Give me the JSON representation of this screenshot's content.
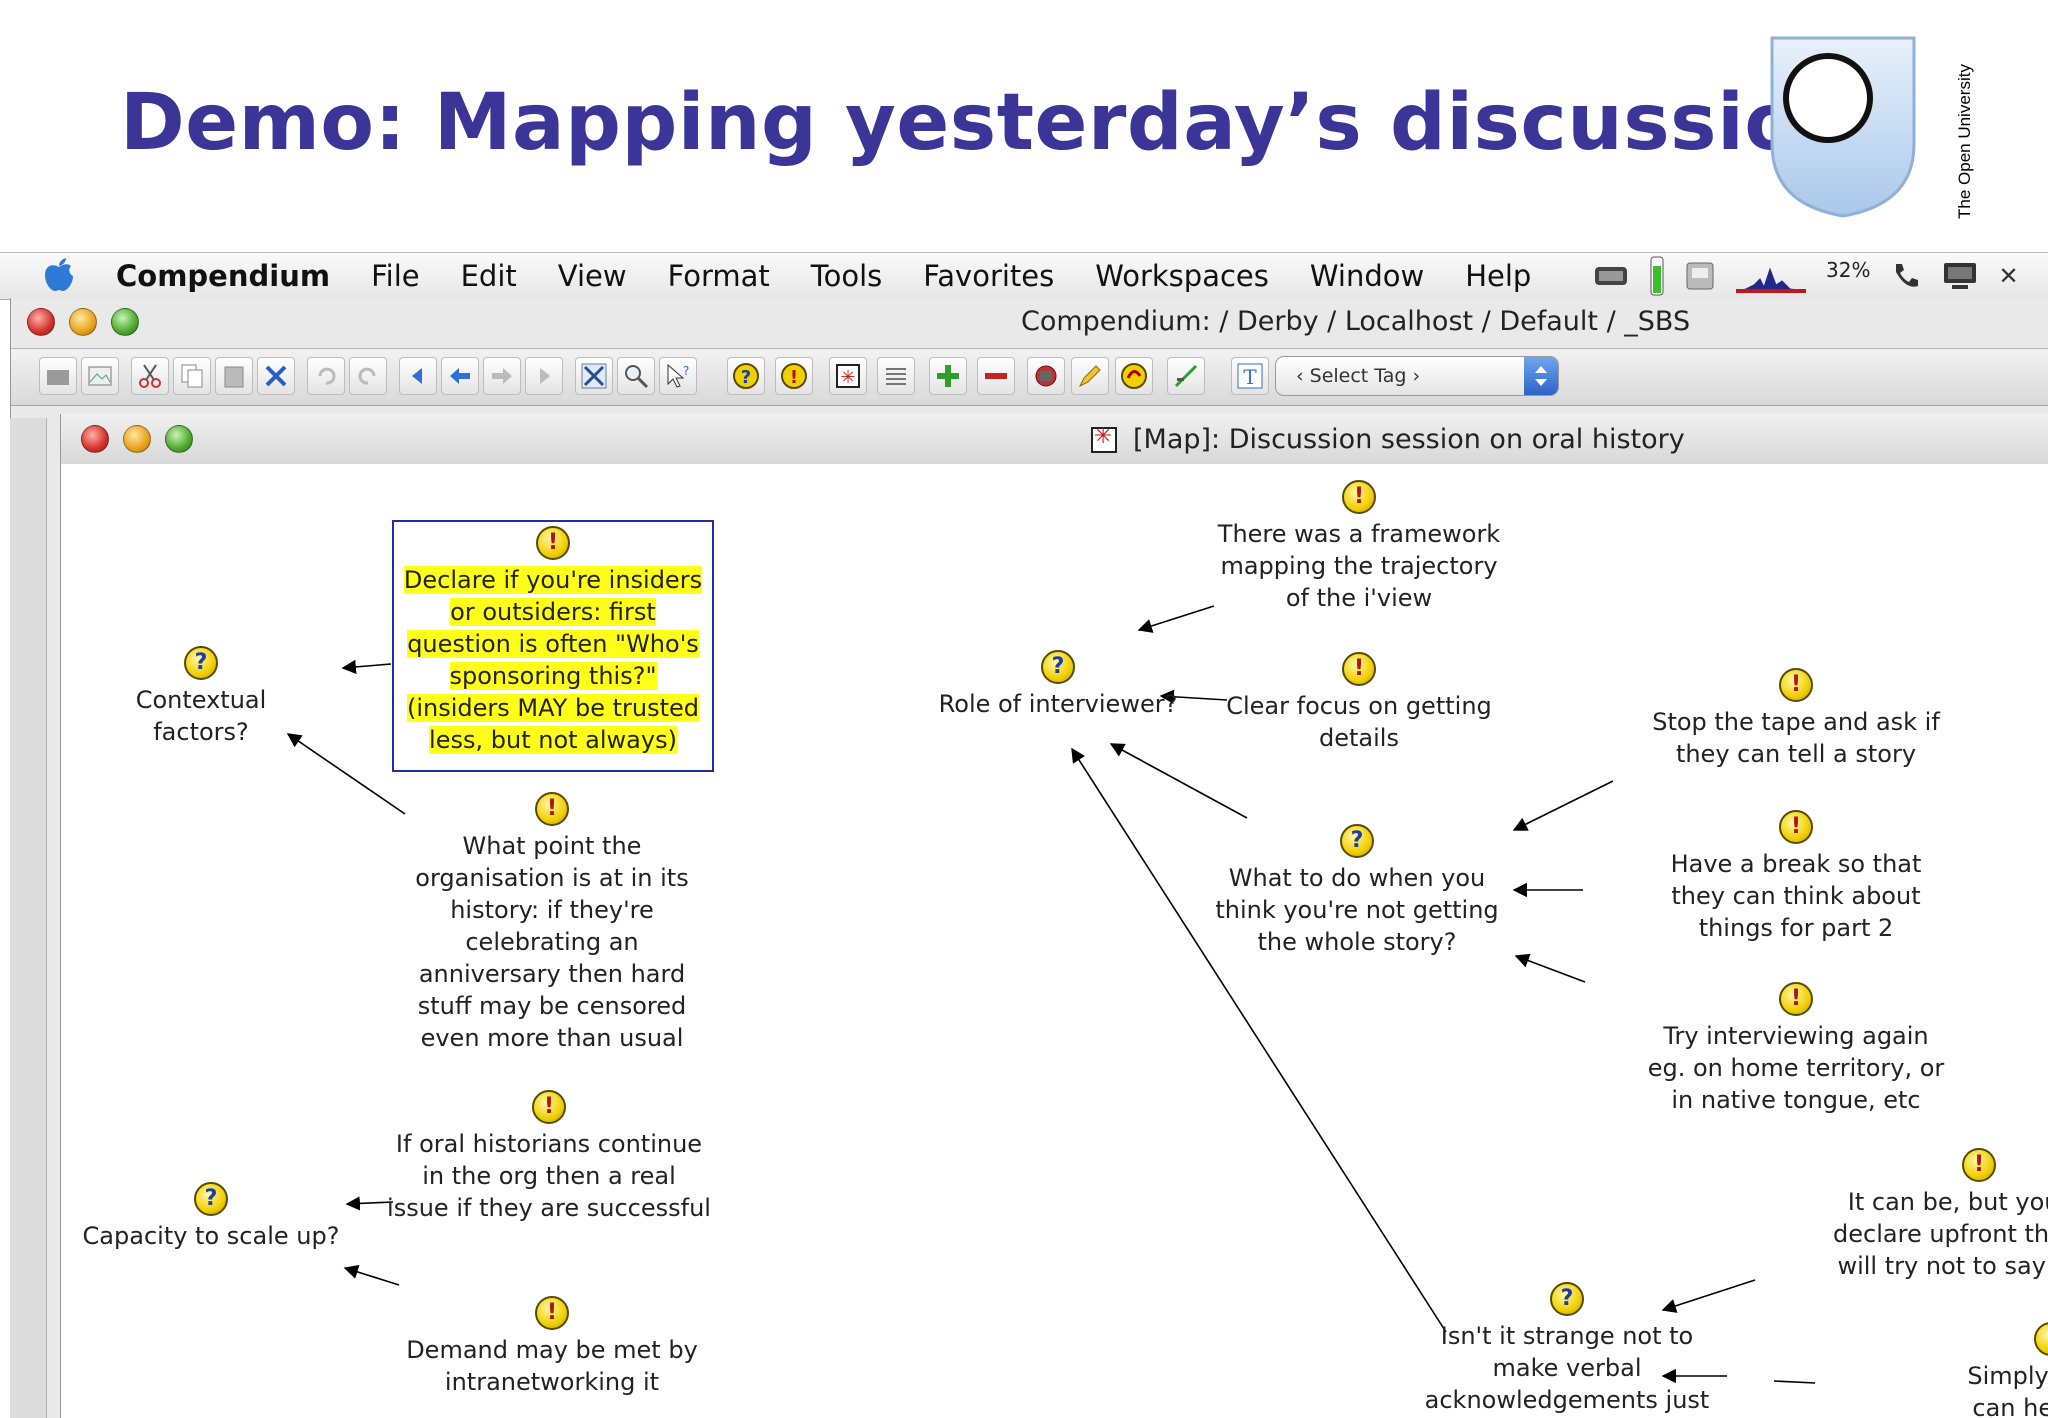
{
  "slide": {
    "title": "Demo: Mapping yesterday’s discussions",
    "logo_caption": "The Open University"
  },
  "menubar": {
    "items": [
      "Compendium",
      "File",
      "Edit",
      "View",
      "Format",
      "Tools",
      "Favorites",
      "Workspaces",
      "Window",
      "Help"
    ],
    "tray_text": "32%"
  },
  "app_window": {
    "title": "Compendium:  / Derby / Localhost / Default / _SBS"
  },
  "toolbar": {
    "tag_select": "‹ Select Tag ›"
  },
  "map_window": {
    "title": "[Map]: Discussion session on oral history"
  },
  "nodes": [
    {
      "type": "issue",
      "text": "Contextual factors?"
    },
    {
      "type": "argument",
      "text": "Declare if you're insiders\nor outsiders: first\nquestion is often \"Who's\nsponsoring this?\"\n(insiders MAY be trusted\nless, but not always)"
    },
    {
      "type": "argument",
      "text": "What point the\norganisation is at in its\nhistory: if they're\ncelebrating an\nanniversary then hard\nstuff may be censored\neven more than usual"
    },
    {
      "type": "argument",
      "text": "If oral historians continue\nin the org then a real\nissue if they are successful"
    },
    {
      "type": "issue",
      "text": "Capacity to scale up?"
    },
    {
      "type": "argument",
      "text": "Demand may be met by\nintranetworking it"
    },
    {
      "type": "argument",
      "text": "There was a framework\nmapping the trajectory\nof the i'view"
    },
    {
      "type": "issue",
      "text": "Role of interviewer?"
    },
    {
      "type": "argument",
      "text": "Clear focus on getting\ndetails"
    },
    {
      "type": "argument",
      "text": "Stop the tape and ask if\nthey can tell a story"
    },
    {
      "type": "issue",
      "text": "What to do when you\nthink you're not getting\nthe whole story?"
    },
    {
      "type": "argument",
      "text": "Have a break so that\nthey can think about\nthings for part 2"
    },
    {
      "type": "argument",
      "text": "Try interviewing again\neg. on home territory, or\nin native tongue, etc"
    },
    {
      "type": "argument",
      "text": "It can be, but you can\ndeclare upfront that you\nwill try not to say much"
    },
    {
      "type": "issue",
      "text": "Isn't it strange not to\nmake verbal\nacknowledgements just"
    },
    {
      "type": "argument",
      "text": "Simply repeat\ncan help to g"
    }
  ],
  "colors": {
    "title": "#3a3596",
    "highlight": "#ffff1a",
    "highlight_border": "#1f2f9e",
    "node_icon": "#f1d000"
  }
}
